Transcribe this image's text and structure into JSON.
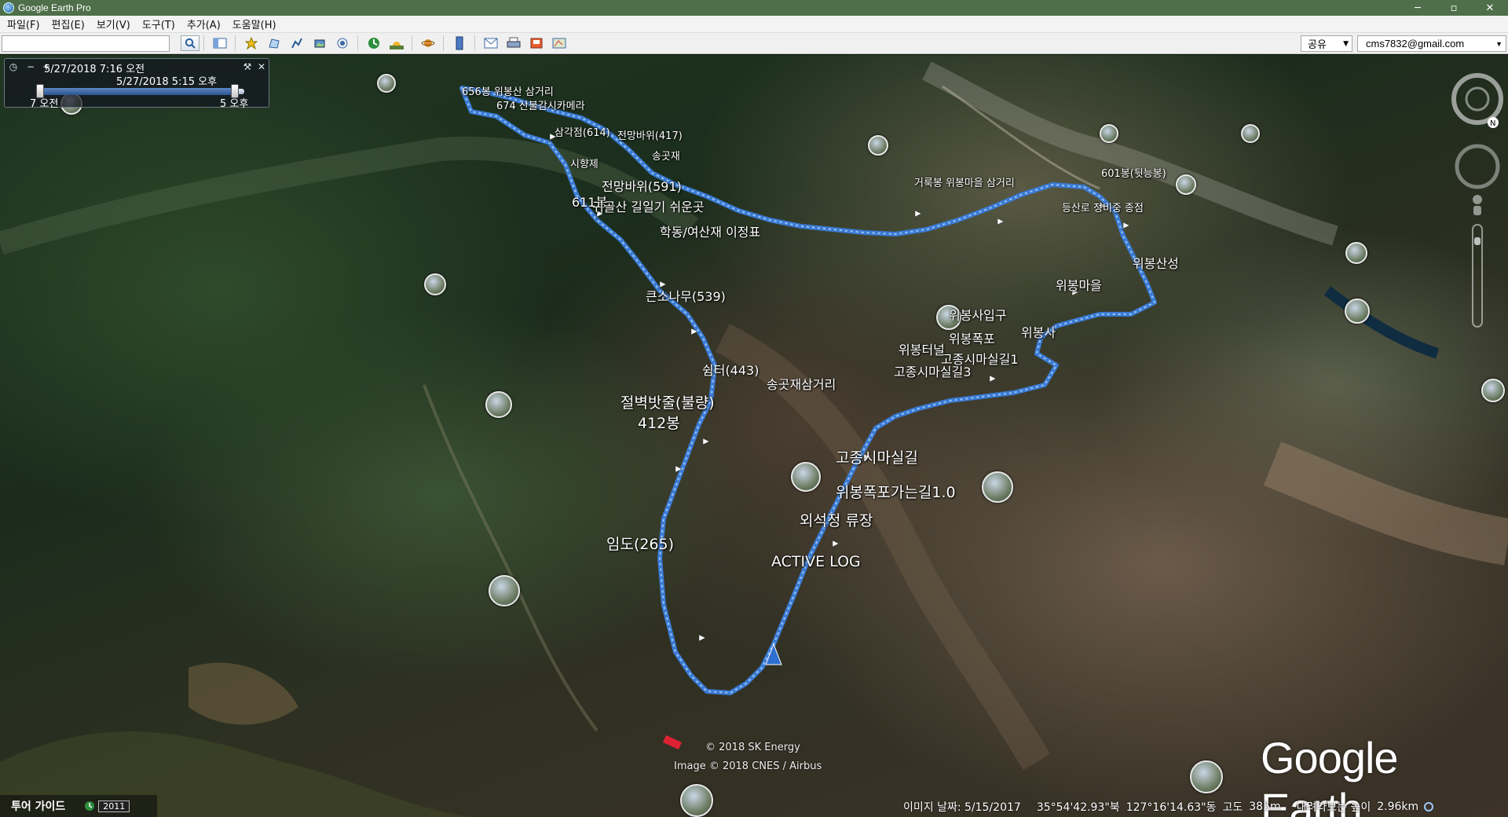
{
  "window": {
    "title": "Google Earth Pro",
    "controls": {
      "minimize": "─",
      "maximize": "▫",
      "close": "✕"
    }
  },
  "menu": [
    "파일(F)",
    "편집(E)",
    "보기(V)",
    "도구(T)",
    "추가(A)",
    "도움말(H)"
  ],
  "toolbar": {
    "search_value": "",
    "share_label": "공유",
    "account_label": "cms7832@gmail.com"
  },
  "time_slider": {
    "start_datetime": "5/27/2018    7:16 오전",
    "end_datetime": "5/27/2018    5:15 오후",
    "left_tick": "7 오전",
    "right_tick": "5 오후"
  },
  "map_labels": [
    "656봉 위봉산 삼거리",
    "674 산불감시카메라",
    "삼각점(614)",
    "전망바위(417)",
    "송곳재",
    "시향제",
    "전망바위(591)",
    "611봉",
    "귀골산 길일기 쉬운곳",
    "학동/여산재 이정표",
    "큰소나무(539)",
    "쉼터(443)",
    "절벽밧줄(불량)",
    "412봉",
    "임도(265)",
    "ACTIVE LOG",
    "외석정 류장",
    "위봉폭포가는길1.0",
    "고종시마실길",
    "송곳재삼거리",
    "고종시마실길3",
    "고종시마실길1",
    "위봉터널",
    "위봉폭포",
    "위봉사입구",
    "위봉사",
    "위봉마을",
    "위봉산성",
    "등산로 정비중 종점",
    "601봉(뒷능봉)",
    "거룩봉 위봉마을 삼거리"
  ],
  "tour_guide": {
    "label": "투어 가이드",
    "year": "2011"
  },
  "credits": {
    "line1": "© 2018 SK Energy",
    "line2": "Image © 2018 CNES / Airbus"
  },
  "logo": "Google Earth",
  "status_bar": {
    "image_date": "이미지 날짜: 5/15/2017",
    "latitude": "35°54'42.93\"북",
    "longitude": "127°16'14.63\"동",
    "elevation_label": "고도",
    "elevation": "385m",
    "eye_alt_label": "내려다보는 높이",
    "eye_alt": "2.96km"
  }
}
